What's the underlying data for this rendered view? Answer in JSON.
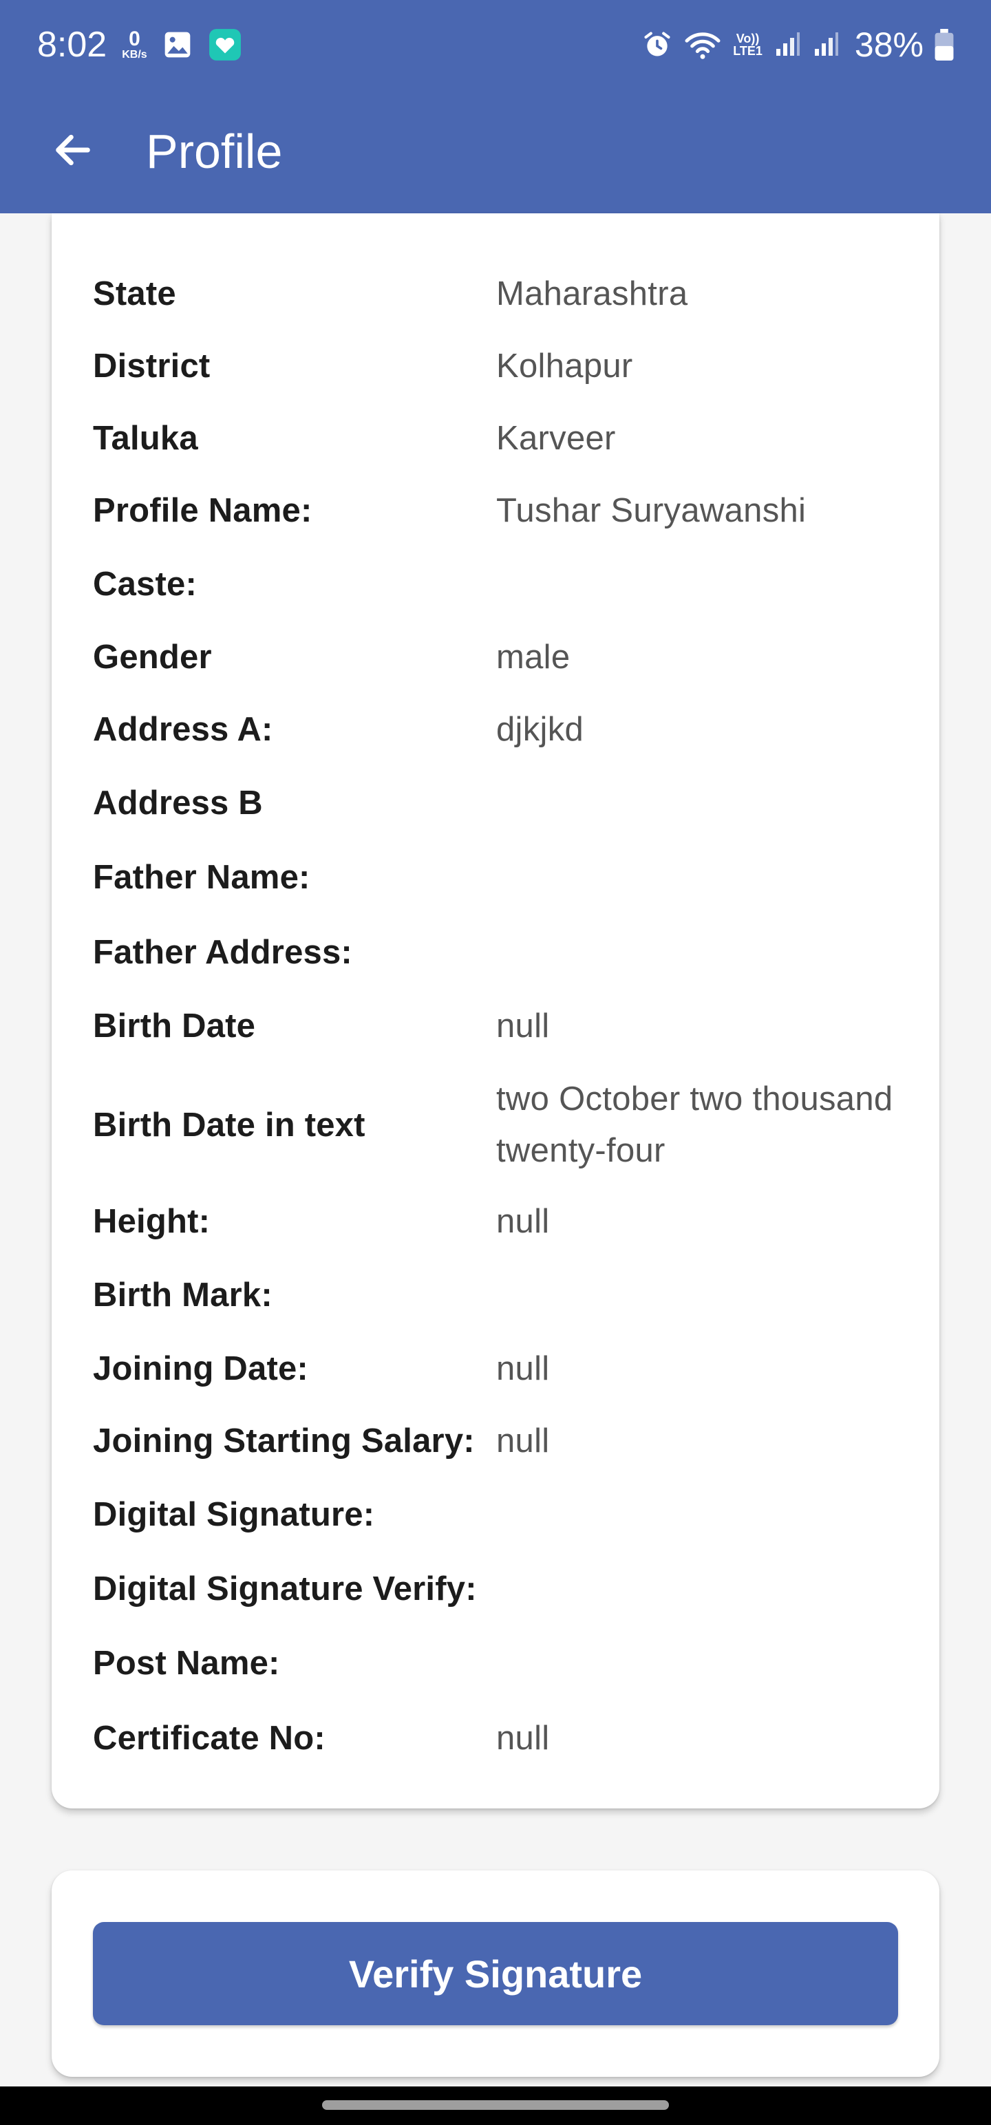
{
  "status_bar": {
    "time": "8:02",
    "net_speed_value": "0",
    "net_speed_unit": "KB/s",
    "volte_top": "Vo))",
    "volte_bottom": "LTE1",
    "battery_percent": "38%",
    "icons": [
      "gallery-icon",
      "app-notification-icon",
      "alarm-icon",
      "wifi-icon",
      "signal-icon",
      "signal-icon",
      "battery-icon"
    ]
  },
  "toolbar": {
    "title": "Profile",
    "back_icon": "arrow-left-icon"
  },
  "profile": {
    "rows": [
      {
        "label": "State",
        "value": "Maharashtra"
      },
      {
        "label": "District",
        "value": "Kolhapur"
      },
      {
        "label": "Taluka",
        "value": "Karveer"
      },
      {
        "label": "Profile Name:",
        "value": "Tushar Suryawanshi"
      },
      {
        "label": "Caste:",
        "value": ""
      },
      {
        "label": "Gender",
        "value": "male"
      },
      {
        "label": "Address A:",
        "value": "djkjkd"
      },
      {
        "label": "Address B",
        "value": ""
      },
      {
        "label": "Father Name:",
        "value": ""
      },
      {
        "label": "Father Address:",
        "value": ""
      },
      {
        "label": "Birth Date",
        "value": "null"
      },
      {
        "label": "Birth Date in text",
        "value": "two October two thousand twenty-four"
      },
      {
        "label": "Height:",
        "value": "null"
      },
      {
        "label": "Birth Mark:",
        "value": ""
      },
      {
        "label": "Joining Date:",
        "value": "null"
      },
      {
        "label": "Joining Starting Salary:",
        "value": "null"
      },
      {
        "label": "Digital Signature:",
        "value": ""
      },
      {
        "label": "Digital Signature Verify:",
        "value": ""
      },
      {
        "label": "Post Name:",
        "value": ""
      },
      {
        "label": "Certificate No:",
        "value": "null"
      }
    ]
  },
  "actions": {
    "verify_label": "Verify Signature"
  },
  "colors": {
    "primary": "#4a67b1",
    "background": "#f5f5f5",
    "card": "#ffffff",
    "label_text": "#1c1c1c",
    "value_text": "#555555"
  }
}
